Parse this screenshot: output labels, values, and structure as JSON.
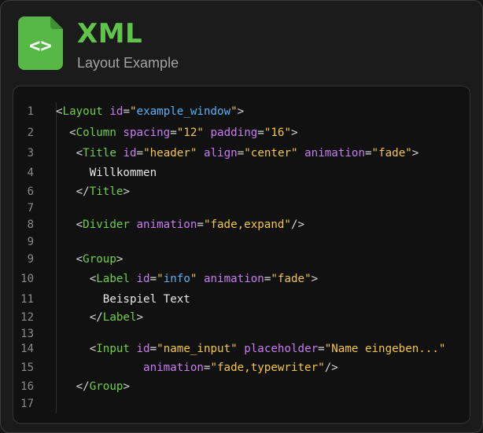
{
  "header": {
    "title": "XML",
    "subtitle": "Layout Example",
    "icon": "code-file-icon",
    "icon_glyph": "<>"
  },
  "colors": {
    "accent_green": "#5fc44a",
    "tag": "#6fcf46",
    "attribute": "#c87cf0",
    "string_quote": "#f2c744",
    "string_value_highlight": "#56b3f5",
    "text": "#e8e8e8",
    "line_number": "#8a8a8a",
    "background": "#1b1b1c",
    "code_background": "#111112"
  },
  "code": {
    "line_numbers": [
      "1",
      "2",
      "3",
      "4",
      "6",
      "7",
      "8",
      "9",
      "9",
      "10",
      "11",
      "12",
      "13",
      "14",
      "15",
      "16",
      "17"
    ],
    "lines": [
      [
        {
          "k": "p",
          "t": "<"
        },
        {
          "k": "tg",
          "t": "Layout"
        },
        {
          "k": "p",
          "t": " "
        },
        {
          "k": "at",
          "t": "id"
        },
        {
          "k": "eq",
          "t": "="
        },
        {
          "k": "st",
          "t": "\""
        },
        {
          "k": "vh",
          "t": "example_window"
        },
        {
          "k": "st",
          "t": "\""
        },
        {
          "k": "p",
          "t": ">"
        }
      ],
      [
        {
          "k": "p",
          "t": "  <"
        },
        {
          "k": "tg",
          "t": "Column"
        },
        {
          "k": "p",
          "t": " "
        },
        {
          "k": "at",
          "t": "spacing"
        },
        {
          "k": "eq",
          "t": "="
        },
        {
          "k": "st",
          "t": "\"12\""
        },
        {
          "k": "p",
          "t": " "
        },
        {
          "k": "at",
          "t": "padding"
        },
        {
          "k": "eq",
          "t": "="
        },
        {
          "k": "st",
          "t": "\"16\""
        },
        {
          "k": "p",
          "t": ">"
        }
      ],
      [
        {
          "k": "p",
          "t": "   <"
        },
        {
          "k": "tg",
          "t": "Title"
        },
        {
          "k": "p",
          "t": " "
        },
        {
          "k": "at",
          "t": "id"
        },
        {
          "k": "eq",
          "t": "="
        },
        {
          "k": "st",
          "t": "\"header\""
        },
        {
          "k": "p",
          "t": " "
        },
        {
          "k": "at",
          "t": "align"
        },
        {
          "k": "eq",
          "t": "="
        },
        {
          "k": "st",
          "t": "\"center\""
        },
        {
          "k": "p",
          "t": " "
        },
        {
          "k": "at",
          "t": "animation"
        },
        {
          "k": "eq",
          "t": "="
        },
        {
          "k": "st",
          "t": "\"fade\""
        },
        {
          "k": "p",
          "t": ">"
        }
      ],
      [
        {
          "k": "tx",
          "t": "     Willkommen"
        }
      ],
      [
        {
          "k": "p",
          "t": "   </"
        },
        {
          "k": "tg",
          "t": "Title"
        },
        {
          "k": "p",
          "t": ">"
        }
      ],
      [],
      [
        {
          "k": "p",
          "t": "   <"
        },
        {
          "k": "tg",
          "t": "Divider"
        },
        {
          "k": "p",
          "t": " "
        },
        {
          "k": "at",
          "t": "animation"
        },
        {
          "k": "eq",
          "t": "="
        },
        {
          "k": "st",
          "t": "\"fade,expand\""
        },
        {
          "k": "p",
          "t": "/>"
        }
      ],
      [],
      [
        {
          "k": "p",
          "t": "   <"
        },
        {
          "k": "tg",
          "t": "Group"
        },
        {
          "k": "p",
          "t": ">"
        }
      ],
      [
        {
          "k": "p",
          "t": "     <"
        },
        {
          "k": "tg",
          "t": "Label"
        },
        {
          "k": "p",
          "t": " "
        },
        {
          "k": "at",
          "t": "id"
        },
        {
          "k": "eq",
          "t": "="
        },
        {
          "k": "st",
          "t": "\""
        },
        {
          "k": "vh",
          "t": "info"
        },
        {
          "k": "st",
          "t": "\""
        },
        {
          "k": "p",
          "t": " "
        },
        {
          "k": "at",
          "t": "animation"
        },
        {
          "k": "eq",
          "t": "="
        },
        {
          "k": "st",
          "t": "\"fade\""
        },
        {
          "k": "p",
          "t": ">"
        }
      ],
      [
        {
          "k": "tx",
          "t": "       Beispiel Text"
        }
      ],
      [
        {
          "k": "p",
          "t": "     </"
        },
        {
          "k": "tg",
          "t": "Label"
        },
        {
          "k": "p",
          "t": ">"
        }
      ],
      [],
      [
        {
          "k": "p",
          "t": "     <"
        },
        {
          "k": "tg",
          "t": "Input"
        },
        {
          "k": "p",
          "t": " "
        },
        {
          "k": "at",
          "t": "id"
        },
        {
          "k": "eq",
          "t": "="
        },
        {
          "k": "st",
          "t": "\"name_input\""
        },
        {
          "k": "p",
          "t": " "
        },
        {
          "k": "at",
          "t": "placeholder"
        },
        {
          "k": "eq",
          "t": "="
        },
        {
          "k": "st",
          "t": "\"Name eingeben...\""
        }
      ],
      [
        {
          "k": "p",
          "t": "             "
        },
        {
          "k": "at",
          "t": "animation"
        },
        {
          "k": "eq",
          "t": "="
        },
        {
          "k": "st",
          "t": "\"fade,typewriter\""
        },
        {
          "k": "p",
          "t": "/>"
        }
      ],
      [
        {
          "k": "p",
          "t": "   </"
        },
        {
          "k": "tg",
          "t": "Group"
        },
        {
          "k": "p",
          "t": ">"
        }
      ],
      []
    ]
  }
}
